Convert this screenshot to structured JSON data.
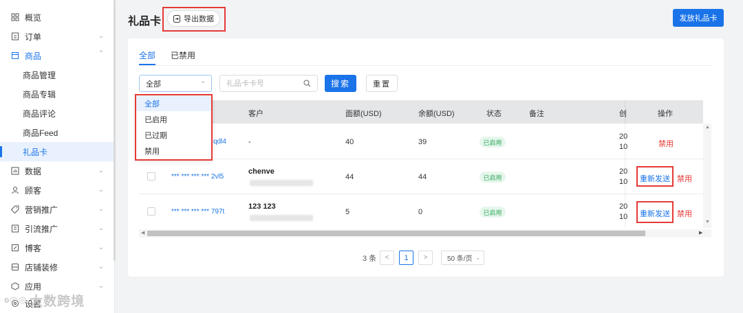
{
  "sidebar": {
    "items": [
      {
        "label": "概览",
        "icon": "grid-icon",
        "expand": ""
      },
      {
        "label": "订单",
        "icon": "order-icon",
        "expand": "down"
      },
      {
        "label": "商品",
        "icon": "product-icon",
        "expand": "up"
      },
      {
        "label": "数据",
        "icon": "data-icon",
        "expand": "down"
      },
      {
        "label": "顾客",
        "icon": "user-icon",
        "expand": "down"
      },
      {
        "label": "营销推广",
        "icon": "tag-icon",
        "expand": "down"
      },
      {
        "label": "引流推广",
        "icon": "doc-icon",
        "expand": "down"
      },
      {
        "label": "博客",
        "icon": "blog-icon",
        "expand": "down"
      },
      {
        "label": "店铺装修",
        "icon": "store-icon",
        "expand": "down"
      },
      {
        "label": "应用",
        "icon": "app-icon",
        "expand": "down"
      },
      {
        "label": "设置",
        "icon": "settings-icon",
        "expand": ""
      }
    ],
    "subitems": [
      "商品管理",
      "商品专辑",
      "商品评论",
      "商品Feed",
      "礼品卡"
    ],
    "watermark": "大数跨境"
  },
  "header": {
    "title": "礼品卡",
    "export_label": "导出数据",
    "issue_label": "发放礼品卡"
  },
  "tabs": [
    "全部",
    "已禁用"
  ],
  "filters": {
    "status_value": "全部",
    "search_placeholder": "礼品卡卡号",
    "search_label": "搜索",
    "reset_label": "重置"
  },
  "dropdown": {
    "options": [
      "全部",
      "已启用",
      "已过期",
      "禁用"
    ]
  },
  "table": {
    "columns": [
      "客户",
      "面额(USD)",
      "余额(USD)",
      "状态",
      "备注",
      "创",
      "操作"
    ],
    "rows": [
      {
        "card": "qdl4",
        "customer": "-",
        "face": "40",
        "balance": "39",
        "status": "已启用",
        "created": [
          "20",
          "10"
        ],
        "actions": [
          "禁用"
        ]
      },
      {
        "card": "*** *** *** *** 2vl5",
        "customer": "chenve",
        "face": "44",
        "balance": "44",
        "status": "已启用",
        "created": [
          "20",
          "10"
        ],
        "actions": [
          "重新发送",
          "禁用"
        ]
      },
      {
        "card": "*** *** *** *** 797t",
        "customer": "123 123",
        "face": "5",
        "balance": "0",
        "status": "已启用",
        "created": [
          "20",
          "10"
        ],
        "actions": [
          "重新发送",
          "禁用"
        ]
      }
    ]
  },
  "pagination": {
    "total": "3 条",
    "page": "1",
    "page_size": "50 条/页",
    "prev": "<",
    "next": ">"
  },
  "colors": {
    "accent": "#1a73e8",
    "highlight": "#e53935",
    "status_green": "#2ea85a"
  }
}
